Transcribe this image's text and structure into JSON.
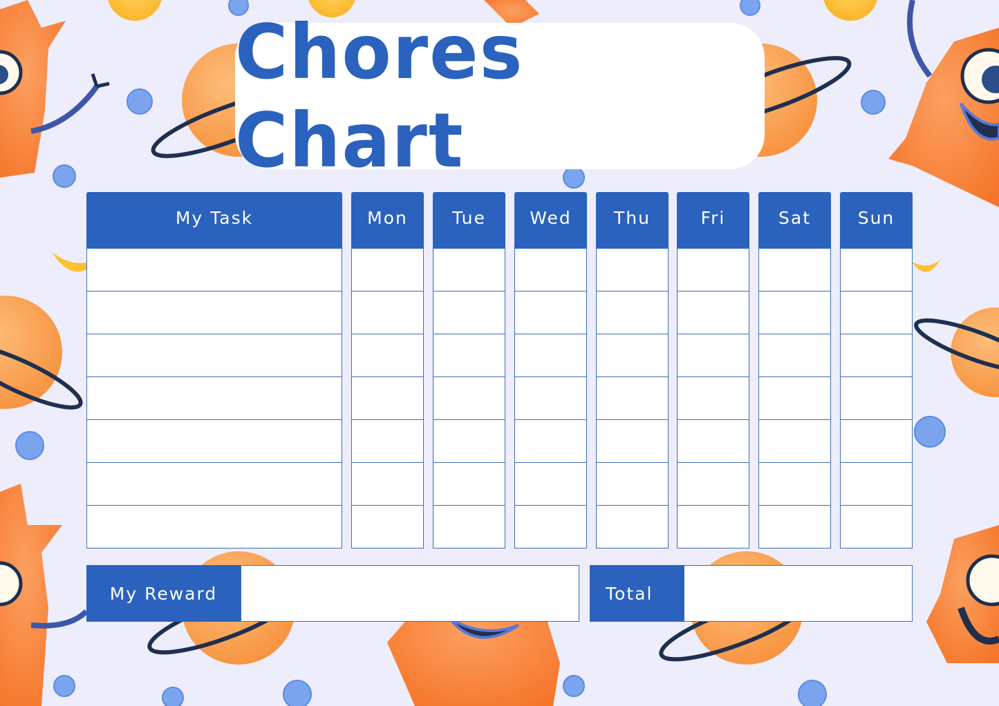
{
  "title": "Chores Chart",
  "colors": {
    "accent": "#2a62bd",
    "background": "#eeedfc",
    "cell_border": "#3d6cb8",
    "monster_orange": "#f7853a",
    "planet_orange": "#f8a35a",
    "moon_yellow": "#fdc43a",
    "star_blue": "#6f9ee8",
    "ring_navy": "#1f2f4f"
  },
  "table": {
    "task_header": "My Task",
    "days": [
      "Mon",
      "Tue",
      "Wed",
      "Thu",
      "Fri",
      "Sat",
      "Sun"
    ],
    "row_count": 7,
    "rows": [
      {
        "task": "",
        "checks": [
          "",
          "",
          "",
          "",
          "",
          "",
          ""
        ]
      },
      {
        "task": "",
        "checks": [
          "",
          "",
          "",
          "",
          "",
          "",
          ""
        ]
      },
      {
        "task": "",
        "checks": [
          "",
          "",
          "",
          "",
          "",
          "",
          ""
        ]
      },
      {
        "task": "",
        "checks": [
          "",
          "",
          "",
          "",
          "",
          "",
          ""
        ]
      },
      {
        "task": "",
        "checks": [
          "",
          "",
          "",
          "",
          "",
          "",
          ""
        ]
      },
      {
        "task": "",
        "checks": [
          "",
          "",
          "",
          "",
          "",
          "",
          ""
        ]
      },
      {
        "task": "",
        "checks": [
          "",
          "",
          "",
          "",
          "",
          "",
          ""
        ]
      }
    ]
  },
  "footer": {
    "reward_label": "My Reward",
    "reward_value": "",
    "total_label": "Total",
    "total_value": ""
  },
  "decorations": [
    "monster-icon",
    "planet-icon",
    "moon-icon",
    "star-blob-icon"
  ]
}
